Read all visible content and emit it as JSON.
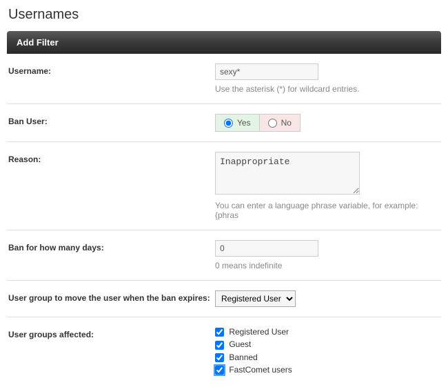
{
  "page_title": "Usernames",
  "filter_header": "Add Filter",
  "fields": {
    "username": {
      "label": "Username:",
      "value": "sexy*",
      "hint": "Use the asterisk (*) for wildcard entries."
    },
    "ban_user": {
      "label": "Ban User:",
      "yes": "Yes",
      "no": "No",
      "selected": "yes"
    },
    "reason": {
      "label": "Reason:",
      "value": "Inappropriate",
      "hint": "You can enter a language phrase variable, for example: {phras"
    },
    "ban_days": {
      "label": "Ban for how many days:",
      "value": "0",
      "hint": "0 means indefinite"
    },
    "user_group_move": {
      "label": "User group to move the user when the ban expires:",
      "selected": "Registered User"
    },
    "user_groups_affected": {
      "label": "User groups affected:",
      "options": [
        {
          "label": "Registered User",
          "checked": true
        },
        {
          "label": "Guest",
          "checked": true
        },
        {
          "label": "Banned",
          "checked": true
        },
        {
          "label": "FastComet users",
          "checked": true,
          "highlight": true
        }
      ]
    }
  }
}
